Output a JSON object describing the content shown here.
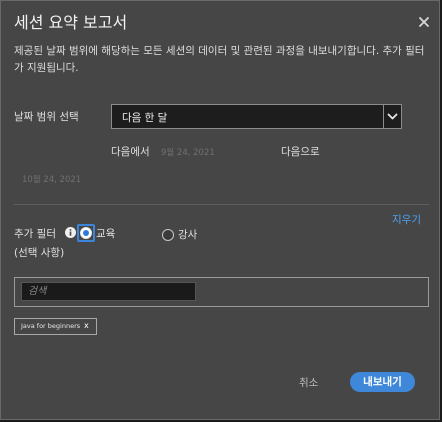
{
  "dialog": {
    "title": "세션 요약 보고서",
    "description": "제공된 날짜 범위에 해당하는 모든 세션의 데이터 및 관련된 과정을 내보내기합니다. 추가 필터가 지원됩니다."
  },
  "date_range": {
    "label": "날짜 범위 선택",
    "selected": "다음 한 달",
    "from_label": "다음에서",
    "from_date": "9월 24, 2021",
    "to_label": "다음으로",
    "to_date": "10월 24, 2021"
  },
  "filters": {
    "label": "추가 필터",
    "optional": "(선택 사항)",
    "clear_link": "지우기",
    "options": [
      {
        "label": "교육",
        "selected": true
      },
      {
        "label": "강사",
        "selected": false
      }
    ],
    "search_placeholder": "검색",
    "chips": [
      {
        "label": "Java for beginners",
        "remove": "x"
      }
    ]
  },
  "footer": {
    "cancel": "취소",
    "export": "내보내기"
  },
  "colors": {
    "dialog_bg": "#464646",
    "accent": "#3f87d8",
    "link": "#4da3f0",
    "input_bg": "#1d1d1d"
  },
  "icons": {
    "close": "close-icon",
    "dropdown": "chevron-down-icon",
    "info": "info-icon"
  }
}
